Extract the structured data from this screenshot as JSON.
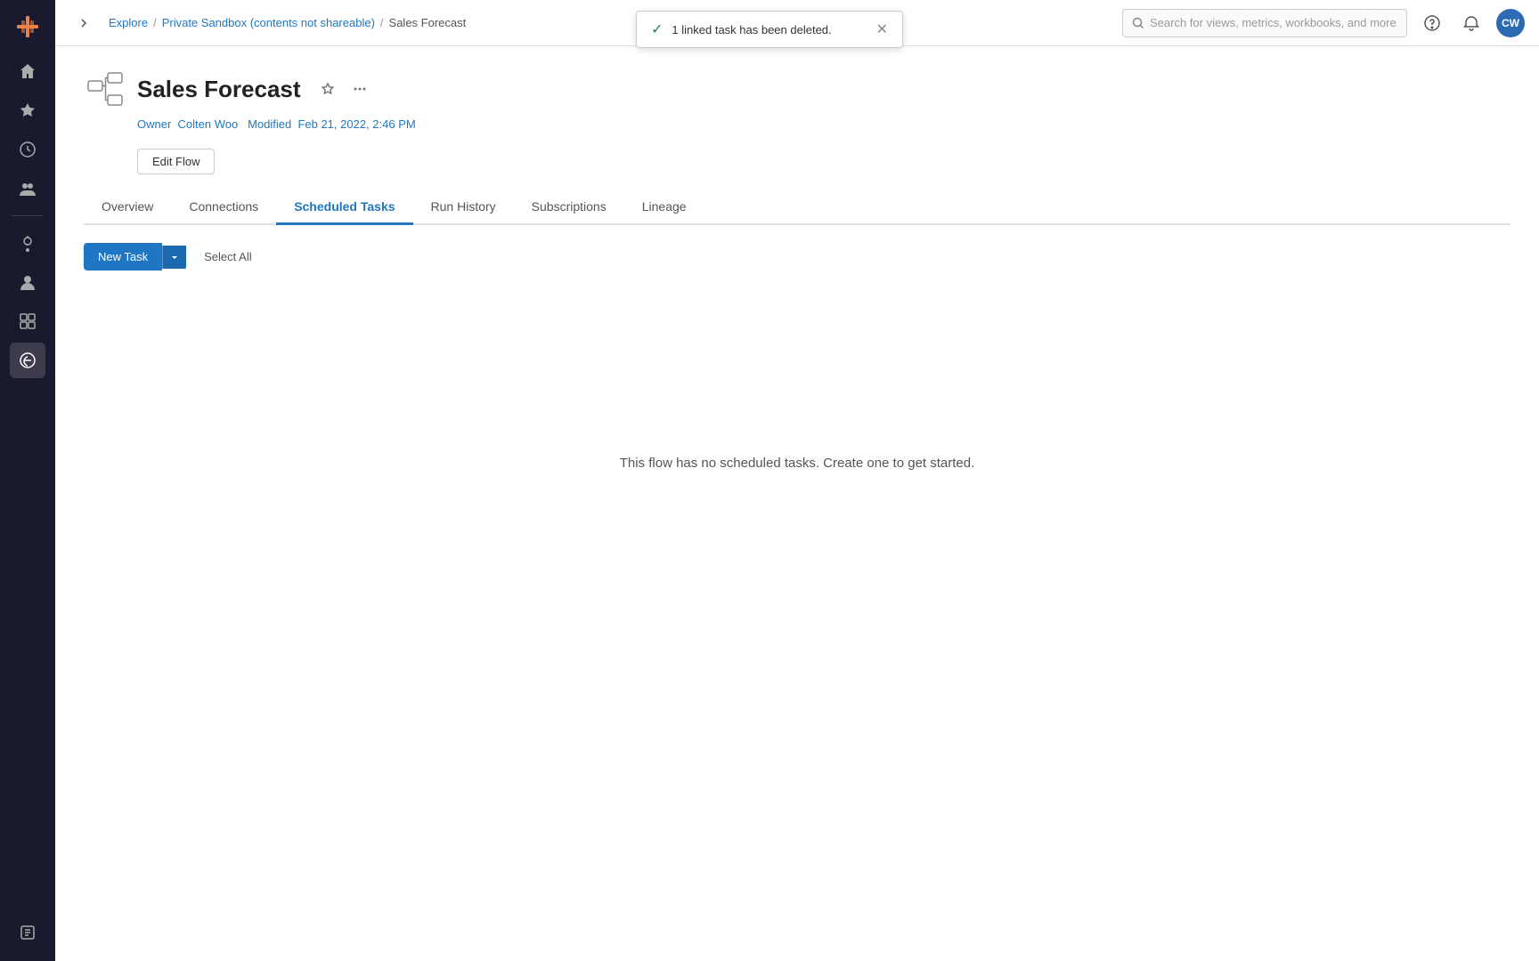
{
  "sidebar": {
    "logo_label": "Tableau",
    "icons": [
      {
        "name": "home-icon",
        "symbol": "⌂",
        "active": false
      },
      {
        "name": "favorites-icon",
        "symbol": "☆",
        "active": false
      },
      {
        "name": "recents-icon",
        "symbol": "◷",
        "active": false
      },
      {
        "name": "groups-icon",
        "symbol": "👥",
        "active": false
      },
      {
        "name": "recommendations-icon",
        "symbol": "💡",
        "active": false
      },
      {
        "name": "user-icon",
        "symbol": "👤",
        "active": false
      },
      {
        "name": "collections-icon",
        "symbol": "⊞",
        "active": false
      },
      {
        "name": "external-icon",
        "symbol": "✿",
        "active": true
      },
      {
        "name": "tasks-icon",
        "symbol": "📋",
        "active": false
      }
    ]
  },
  "topnav": {
    "breadcrumbs": [
      {
        "label": "Explore",
        "href": "#"
      },
      {
        "label": "Private Sandbox (contents not shareable)",
        "href": "#"
      },
      {
        "label": "Sales Forecast",
        "href": null
      }
    ],
    "search_placeholder": "Search for views, metrics, workbooks, and more"
  },
  "avatar": {
    "initials": "CW"
  },
  "toast": {
    "message": "1 linked task has been deleted.",
    "visible": true
  },
  "flow": {
    "title": "Sales Forecast",
    "owner_label": "Owner",
    "owner_name": "Colten Woo",
    "modified_label": "Modified",
    "modified_date": "Feb 21, 2022, 2:46 PM"
  },
  "edit_flow_btn": "Edit Flow",
  "tabs": [
    {
      "id": "overview",
      "label": "Overview",
      "active": false
    },
    {
      "id": "connections",
      "label": "Connections",
      "active": false
    },
    {
      "id": "scheduled-tasks",
      "label": "Scheduled Tasks",
      "active": true
    },
    {
      "id": "run-history",
      "label": "Run History",
      "active": false
    },
    {
      "id": "subscriptions",
      "label": "Subscriptions",
      "active": false
    },
    {
      "id": "lineage",
      "label": "Lineage",
      "active": false
    }
  ],
  "toolbar": {
    "new_task_label": "New Task",
    "select_all_label": "Select All"
  },
  "empty_state": {
    "message": "This flow has no scheduled tasks. Create one to get started."
  }
}
